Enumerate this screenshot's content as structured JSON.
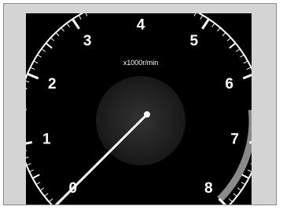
{
  "gauge": {
    "unit": "x1000r/min",
    "scale_labels": [
      "0",
      "1",
      "2",
      "3",
      "4",
      "5",
      "6",
      "7",
      "8"
    ],
    "min": 0,
    "max": 8,
    "needle_value": 0,
    "redline_start": 6.5,
    "colors": {
      "panel": "#000000",
      "frame": "#d4d4d4",
      "ticks": "#ffffff",
      "redline": "#8a8a8a",
      "hub": "#2a2a2a"
    }
  }
}
